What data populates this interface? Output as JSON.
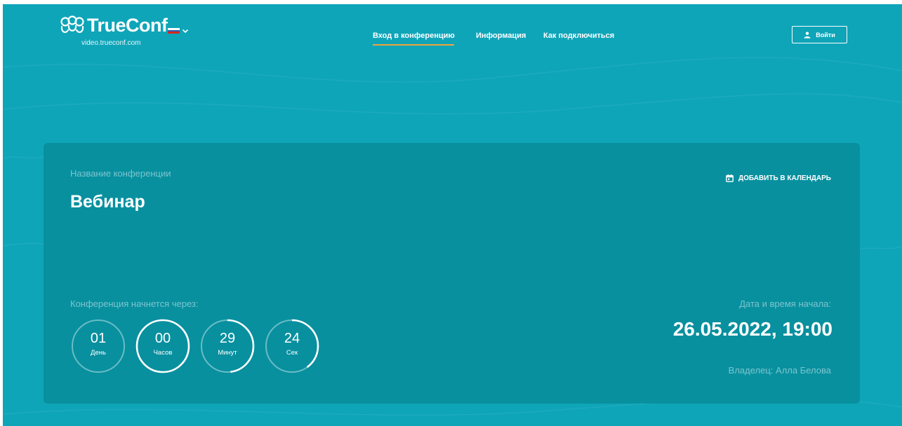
{
  "brand": {
    "name": "TrueConf",
    "domain": "video.trueconf.com",
    "logo_icon": "trueconf-logo-icon"
  },
  "language": {
    "icon": "russian-flag-icon",
    "flag_colors": [
      "#ffffff",
      "#2f58b5",
      "#d52b1e"
    ]
  },
  "nav": {
    "items": [
      {
        "label": "Вход в конференцию",
        "active": true
      },
      {
        "label": "Информация",
        "active": false
      },
      {
        "label": "Как подключиться",
        "active": false
      }
    ]
  },
  "login": {
    "label": "Войти",
    "icon": "user-icon"
  },
  "conference": {
    "name_label": "Название конференции",
    "name": "Вебинар",
    "add_to_calendar": "ДОБАВИТЬ В КАЛЕНДАРЬ",
    "calendar_icon": "calendar-icon",
    "countdown_label": "Конференция начнется через:",
    "countdown": [
      {
        "value": "01",
        "unit": "День",
        "progress": 0.0
      },
      {
        "value": "00",
        "unit": "Часов",
        "progress": 1.0
      },
      {
        "value": "29",
        "unit": "Минут",
        "progress": 0.48
      },
      {
        "value": "24",
        "unit": "Сек",
        "progress": 0.4
      }
    ],
    "start_label": "Дата и время начала:",
    "start_datetime": "26.05.2022, 19:00",
    "owner": "Владелец: Алла Белова"
  },
  "colors": {
    "background": "#0fa5b9",
    "card": "#08909f",
    "accent_underline": "#f1a33a",
    "muted_text": "#7dc5ce"
  }
}
